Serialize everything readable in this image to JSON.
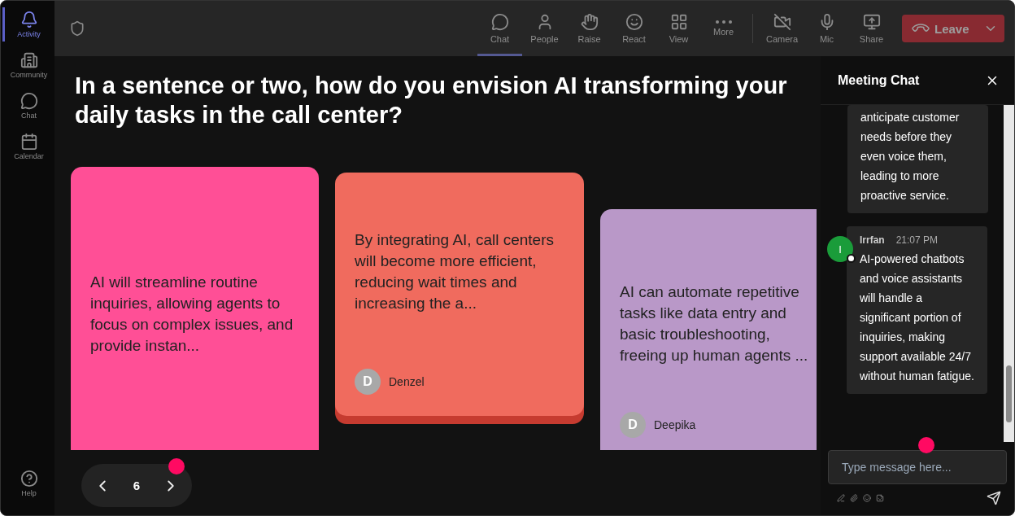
{
  "sidebar": {
    "items": [
      {
        "label": "Activity",
        "selected": true
      },
      {
        "label": "Community",
        "selected": false
      },
      {
        "label": "Chat",
        "selected": false
      },
      {
        "label": "Calendar",
        "selected": false
      }
    ],
    "help": {
      "label": "Help"
    }
  },
  "toolbar": {
    "items": [
      {
        "label": "Chat",
        "selected": true
      },
      {
        "label": "People",
        "selected": false
      },
      {
        "label": "Raise",
        "selected": false
      },
      {
        "label": "React",
        "selected": false
      },
      {
        "label": "View",
        "selected": false
      },
      {
        "label": "More",
        "selected": false
      }
    ],
    "devices": [
      {
        "label": "Camera"
      },
      {
        "label": "Mic"
      },
      {
        "label": "Share"
      }
    ],
    "leave": "Leave"
  },
  "question": "In a sentence or two, how do you envision AI transforming your daily tasks in the call center?",
  "cards": [
    {
      "text": "AI will streamline routine inquiries, allowing agents to focus on complex issues, and provide instan...",
      "color": "#ff4f96"
    },
    {
      "text": "By integrating AI, call centers will become more efficient, reducing wait times and increasing the a...",
      "author": "Denzel",
      "initial": "D",
      "color": "#f06b5e"
    },
    {
      "text": "AI can automate repetitive tasks like data entry and basic troubleshooting, freeing up human agents ...",
      "author": "Deepika",
      "initial": "D",
      "color": "#b998c8"
    }
  ],
  "pager": {
    "page": "6"
  },
  "chat": {
    "title": "Meeting Chat",
    "messages": [
      {
        "text": "anticipate customer needs before they even voice them, leading to more proactive service."
      },
      {
        "author": "Irrfan",
        "initial": "I",
        "time": "21:07 PM",
        "text": "AI-powered chatbots and voice assistants will handle a significant portion of inquiries, making support available 24/7 without human fatigue."
      }
    ],
    "input": {
      "placeholder": "Type message here..."
    }
  }
}
